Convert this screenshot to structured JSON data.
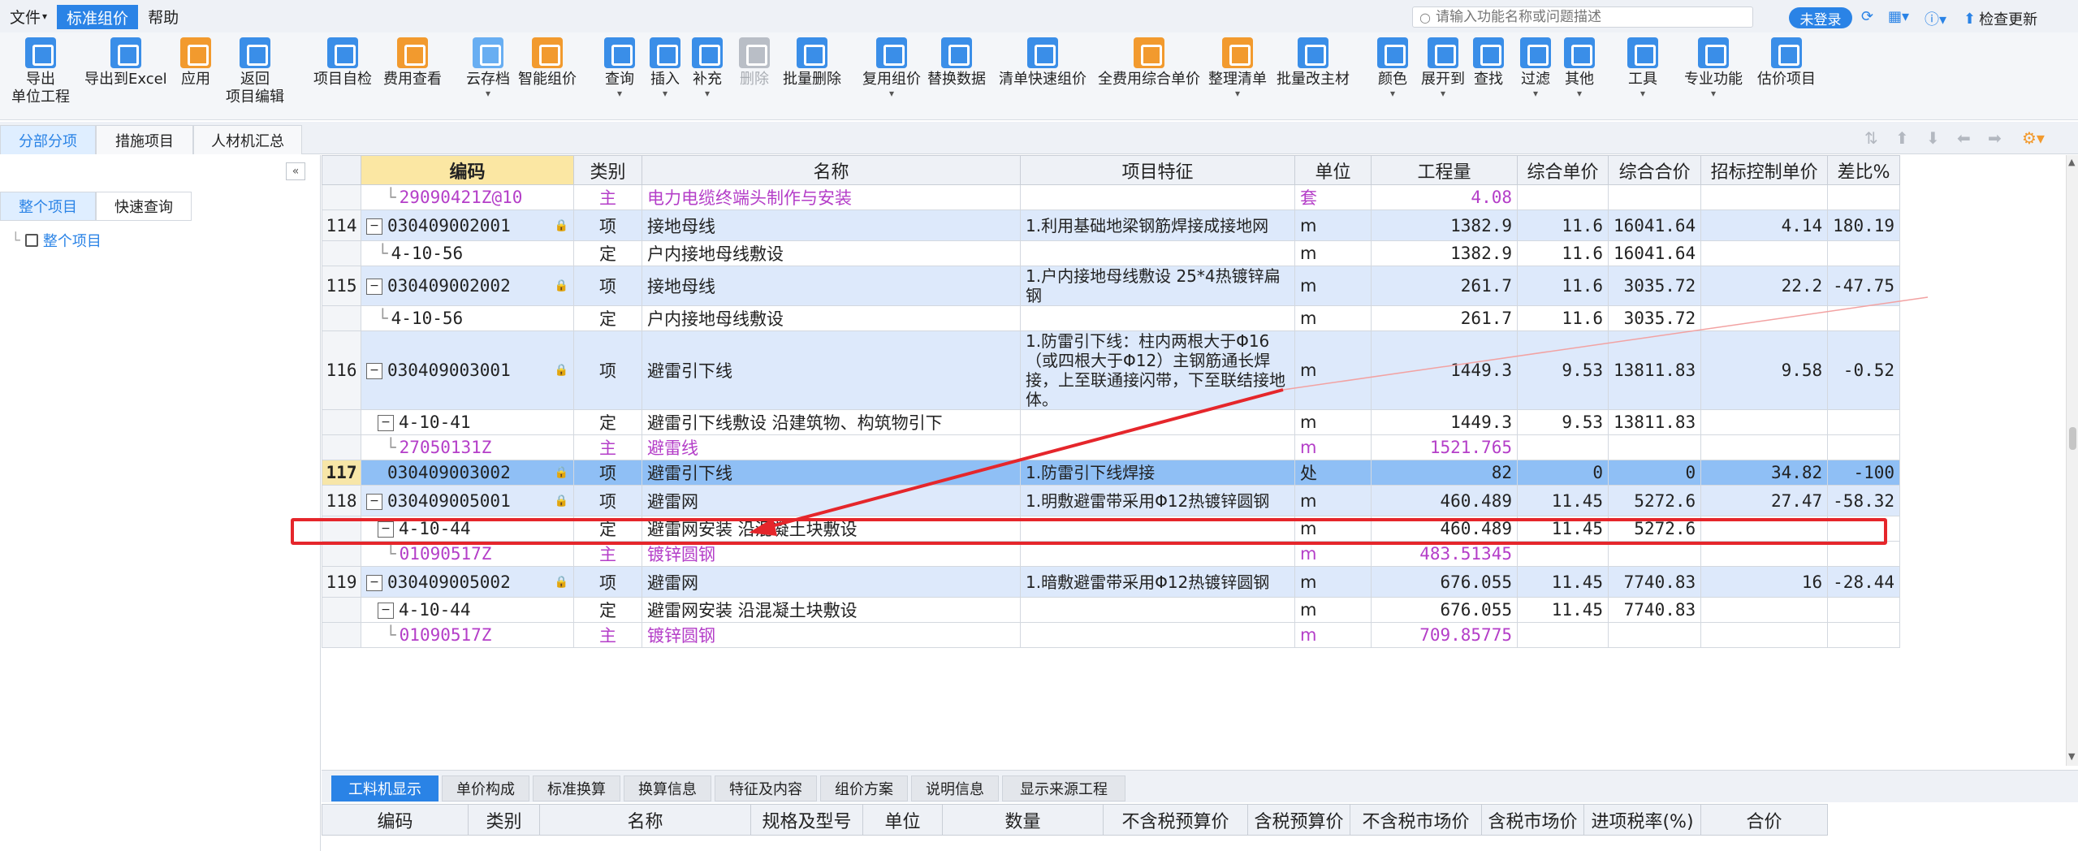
{
  "menubar": {
    "file": "文件",
    "active_tab": "标准组价",
    "help": "帮助",
    "search_placeholder": "请输入功能名称或问题描述",
    "login": "未登录",
    "check_update": "检查更新"
  },
  "ribbon": {
    "export_unit_1": "导出",
    "export_unit_2": "单位工程",
    "export_excel": "导出到Excel",
    "apply": "应用",
    "back_1": "返回",
    "back_2": "项目编辑",
    "self_check": "项目自检",
    "fee_view": "费用查看",
    "cloud": "云存档",
    "smart": "智能组价",
    "query": "查询",
    "insert": "插入",
    "supplement": "补充",
    "delete": "删除",
    "batch_delete": "批量删除",
    "reuse": "复用组价",
    "replace": "替换数据",
    "quick": "清单快速组价",
    "all_fee": "全费用综合单价",
    "arrange": "整理清单",
    "batch_main": "批量改主材",
    "color": "颜色",
    "expand": "展开到",
    "find": "查找",
    "filter": "过滤",
    "other": "其他",
    "tools": "工具",
    "pro": "专业功能",
    "estimate": "估价项目"
  },
  "view_tabs": [
    "分部分项",
    "措施项目",
    "人材机汇总"
  ],
  "left_panel": {
    "tabs": [
      "整个项目",
      "快速查询"
    ],
    "tree_root": "整个项目"
  },
  "grid": {
    "headers": [
      "",
      "编码",
      "类别",
      "名称",
      "项目特征",
      "单位",
      "工程量",
      "综合单价",
      "综合合价",
      "招标控制单价",
      "差比%"
    ],
    "rows": [
      {
        "rn": "",
        "kind": "mat",
        "code": "29090421Z@10",
        "type": "主",
        "name": "电力电缆终端头制作与安装",
        "feat": "",
        "unit": "套",
        "qty": "4.08",
        "up": "",
        "total": "",
        "ctrl": "",
        "diff": ""
      },
      {
        "rn": "114",
        "kind": "item",
        "code": "030409002001",
        "type": "项",
        "name": "接地母线",
        "feat": "1.利用基础地梁钢筋焊接成接地网",
        "unit": "m",
        "qty": "1382.9",
        "up": "11.6",
        "total": "16041.64",
        "ctrl": "4.14",
        "diff": "180.19"
      },
      {
        "rn": "",
        "kind": "quota",
        "code": "4-10-56",
        "type": "定",
        "name": "户内接地母线敷设",
        "feat": "",
        "unit": "m",
        "qty": "1382.9",
        "up": "11.6",
        "total": "16041.64",
        "ctrl": "",
        "diff": ""
      },
      {
        "rn": "115",
        "kind": "item",
        "code": "030409002002",
        "type": "项",
        "name": "接地母线",
        "feat": "1.户内接地母线敷设 25*4热镀锌扁钢",
        "unit": "m",
        "qty": "261.7",
        "up": "11.6",
        "total": "3035.72",
        "ctrl": "22.2",
        "diff": "-47.75"
      },
      {
        "rn": "",
        "kind": "quota",
        "code": "4-10-56",
        "type": "定",
        "name": "户内接地母线敷设",
        "feat": "",
        "unit": "m",
        "qty": "261.7",
        "up": "11.6",
        "total": "3035.72",
        "ctrl": "",
        "diff": ""
      },
      {
        "rn": "116",
        "kind": "item",
        "code": "030409003001",
        "type": "项",
        "name": "避雷引下线",
        "feat": "1.防雷引下线：柱内两根大于Φ16（或四根大于Φ12）主钢筋通长焊接，上至联通接闪带，下至联结接地体。",
        "unit": "m",
        "qty": "1449.3",
        "up": "9.53",
        "total": "13811.83",
        "ctrl": "9.58",
        "diff": "-0.52"
      },
      {
        "rn": "",
        "kind": "quota2",
        "code": "4-10-41",
        "type": "定",
        "name": "避雷引下线敷设 沿建筑物、构筑物引下",
        "feat": "",
        "unit": "m",
        "qty": "1449.3",
        "up": "9.53",
        "total": "13811.83",
        "ctrl": "",
        "diff": ""
      },
      {
        "rn": "",
        "kind": "mat",
        "code": "27050131Z",
        "type": "主",
        "name": "避雷线",
        "feat": "",
        "unit": "m",
        "qty": "1521.765",
        "up": "",
        "total": "",
        "ctrl": "",
        "diff": ""
      },
      {
        "rn": "117",
        "kind": "sel",
        "code": "030409003002",
        "type": "项",
        "name": "避雷引下线",
        "feat": "1.防雷引下线焊接",
        "unit": "处",
        "qty": "82",
        "up": "0",
        "total": "0",
        "ctrl": "34.82",
        "diff": "-100"
      },
      {
        "rn": "118",
        "kind": "item",
        "code": "030409005001",
        "type": "项",
        "name": "避雷网",
        "feat": "1.明敷避雷带采用Φ12热镀锌圆钢",
        "unit": "m",
        "qty": "460.489",
        "up": "11.45",
        "total": "5272.6",
        "ctrl": "27.47",
        "diff": "-58.32"
      },
      {
        "rn": "",
        "kind": "quota2",
        "code": "4-10-44",
        "type": "定",
        "name": "避雷网安装 沿混凝土块敷设",
        "feat": "",
        "unit": "m",
        "qty": "460.489",
        "up": "11.45",
        "total": "5272.6",
        "ctrl": "",
        "diff": ""
      },
      {
        "rn": "",
        "kind": "mat",
        "code": "01090517Z",
        "type": "主",
        "name": "镀锌圆钢",
        "feat": "",
        "unit": "m",
        "qty": "483.51345",
        "up": "",
        "total": "",
        "ctrl": "",
        "diff": ""
      },
      {
        "rn": "119",
        "kind": "item",
        "code": "030409005002",
        "type": "项",
        "name": "避雷网",
        "feat": "1.暗敷避雷带采用Φ12热镀锌圆钢",
        "unit": "m",
        "qty": "676.055",
        "up": "11.45",
        "total": "7740.83",
        "ctrl": "16",
        "diff": "-28.44"
      },
      {
        "rn": "",
        "kind": "quota2",
        "code": "4-10-44",
        "type": "定",
        "name": "避雷网安装 沿混凝土块敷设",
        "feat": "",
        "unit": "m",
        "qty": "676.055",
        "up": "11.45",
        "total": "7740.83",
        "ctrl": "",
        "diff": ""
      },
      {
        "rn": "",
        "kind": "mat",
        "code": "01090517Z",
        "type": "主",
        "name": "镀锌圆钢",
        "feat": "",
        "unit": "m",
        "qty": "709.85775",
        "up": "",
        "total": "",
        "ctrl": "",
        "diff": ""
      }
    ]
  },
  "bottom_tabs": [
    "工料机显示",
    "单价构成",
    "标准换算",
    "换算信息",
    "特征及内容",
    "组价方案",
    "说明信息",
    "显示来源工程"
  ],
  "bottom_headers": [
    "编码",
    "类别",
    "名称",
    "规格及型号",
    "单位",
    "数量",
    "不含税预算价",
    "含税预算价",
    "不含税市场价",
    "含税市场价",
    "进项税率(%)",
    "合价"
  ],
  "colors": {
    "accent": "#2a83e6",
    "annotation": "#e5262b",
    "main_material": "#b43ec8",
    "selected_row": "#8fbff5"
  }
}
